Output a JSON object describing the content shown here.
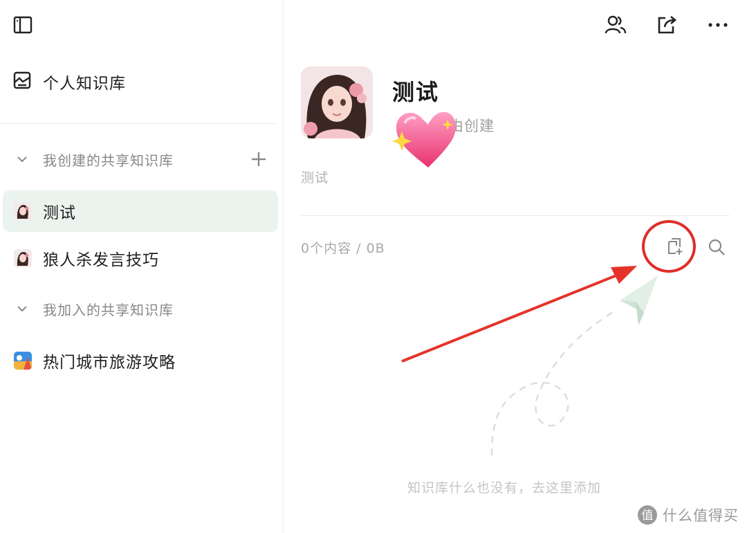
{
  "sidebar": {
    "personal_label": "个人知识库",
    "created_section": "我创建的共享知识库",
    "joined_section": "我加入的共享知识库",
    "created_items": [
      {
        "label": "测试",
        "active": true
      },
      {
        "label": "狼人杀发言技巧",
        "active": false
      }
    ],
    "joined_items": [
      {
        "label": "热门城市旅游攻略"
      }
    ]
  },
  "main": {
    "title": "测试",
    "creator": "由创建",
    "description": "测试",
    "stats": "0个内容 / 0B",
    "empty_message": "知识库什么也没有，去这里添加"
  },
  "watermark": {
    "text": "什么值得买",
    "logo": "值"
  },
  "colors": {
    "accent_bg": "#ebf3ee",
    "highlight": "#e02d27",
    "muted_text": "#a8a8a8"
  }
}
